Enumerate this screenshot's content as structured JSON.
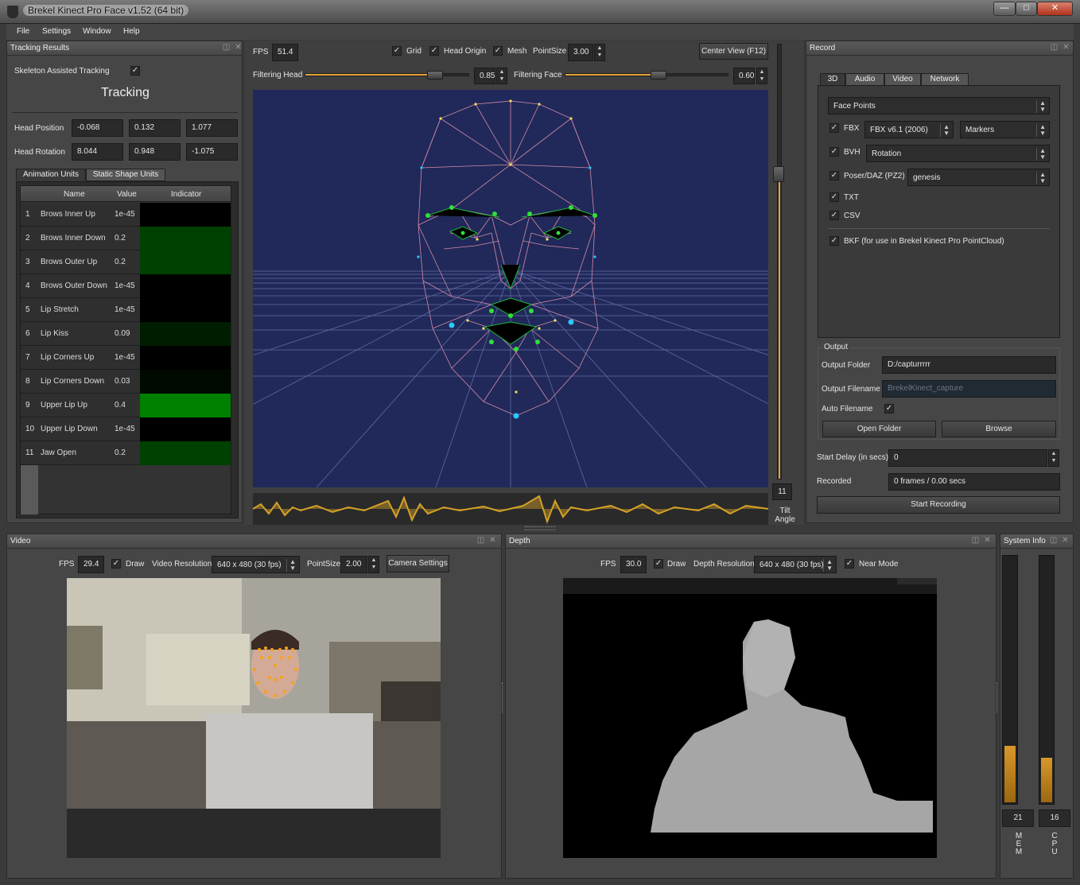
{
  "window": {
    "title": "Brekel Kinect Pro Face v1.52 (64 bit)",
    "min": "—",
    "max": "□",
    "close": "✕"
  },
  "menu": [
    "File",
    "Settings",
    "Window",
    "Help"
  ],
  "tracking": {
    "panel_title": "Tracking Results",
    "skeleton_label": "Skeleton Assisted Tracking",
    "status": "Tracking",
    "head_position_label": "Head Position",
    "head_position": [
      "-0.068",
      "0.132",
      "1.077"
    ],
    "head_rotation_label": "Head Rotation",
    "head_rotation": [
      "8.044",
      "0.948",
      "-1.075"
    ],
    "tabs": [
      "Animation Units",
      "Static Shape Units"
    ],
    "columns": [
      "Name",
      "Value",
      "Indicator"
    ],
    "rows": [
      {
        "n": "1",
        "name": "Brows Inner Up",
        "value": "1e-45",
        "level": 0
      },
      {
        "n": "2",
        "name": "Brows Inner Down",
        "value": "0.2",
        "level": 0.2
      },
      {
        "n": "3",
        "name": "Brows Outer Up",
        "value": "0.2",
        "level": 0.2
      },
      {
        "n": "4",
        "name": "Brows Outer Down",
        "value": "1e-45",
        "level": 0
      },
      {
        "n": "5",
        "name": "Lip Stretch",
        "value": "1e-45",
        "level": 0
      },
      {
        "n": "6",
        "name": "Lip Kiss",
        "value": "0.09",
        "level": 0.09
      },
      {
        "n": "7",
        "name": "Lip Corners Up",
        "value": "1e-45",
        "level": 0
      },
      {
        "n": "8",
        "name": "Lip Corners Down",
        "value": "0.03",
        "level": 0.03
      },
      {
        "n": "9",
        "name": "Upper Lip Up",
        "value": "0.4",
        "level": 0.4
      },
      {
        "n": "10",
        "name": "Upper Lip Down",
        "value": "1e-45",
        "level": 0
      },
      {
        "n": "11",
        "name": "Jaw Open",
        "value": "0.2",
        "level": 0.2
      }
    ]
  },
  "view3d": {
    "fps_label": "FPS",
    "fps": "51.4",
    "grid_label": "Grid",
    "head_origin_label": "Head Origin",
    "mesh_label": "Mesh",
    "pointsize_label": "PointSize",
    "pointsize": "3.00",
    "center_view": "Center View (F12)",
    "filter_head_label": "Filtering Head",
    "filter_head": "0.85",
    "filter_face_label": "Filtering Face",
    "filter_face": "0.60",
    "tilt_value": "11",
    "tilt_label_1": "Tilt",
    "tilt_label_2": "Angle"
  },
  "record": {
    "panel_title": "Record",
    "tabs": [
      "3D",
      "Audio",
      "Video",
      "Network"
    ],
    "face_points": "Face Points",
    "fbx_label": "FBX",
    "fbx_version": "FBX v6.1 (2006)",
    "fbx_mode": "Markers",
    "bvh_label": "BVH",
    "bvh_mode": "Rotation",
    "poser_label": "Poser/DAZ (PZ2)",
    "poser_mode": "genesis",
    "txt_label": "TXT",
    "csv_label": "CSV",
    "bkf_label": "BKF (for use in Brekel Kinect Pro PointCloud)",
    "output_group": "Output",
    "output_folder_label": "Output Folder",
    "output_folder": "D:/capturrrrr",
    "output_filename_label": "Output Filename",
    "output_filename_placeholder": "BrekelKinect_capture",
    "auto_filename_label": "Auto Filename",
    "open_folder": "Open Folder",
    "browse": "Browse",
    "start_delay_label": "Start Delay (in secs)",
    "start_delay": "0",
    "recorded_label": "Recorded",
    "recorded": "0 frames / 0.00 secs",
    "start_recording": "Start Recording"
  },
  "video": {
    "panel_title": "Video",
    "fps_label": "FPS",
    "fps": "29.4",
    "draw_label": "Draw",
    "res_label": "Video Resolution",
    "resolution": "640 x 480  (30 fps)",
    "pointsize_label": "PointSize",
    "pointsize": "2.00",
    "camera_settings": "Camera Settings"
  },
  "depth": {
    "panel_title": "Depth",
    "fps_label": "FPS",
    "fps": "30.0",
    "draw_label": "Draw",
    "res_label": "Depth Resolution",
    "resolution": "640 x 480 (30 fps)",
    "near_mode_label": "Near Mode"
  },
  "sysinfo": {
    "panel_title": "System Info",
    "mem": "21",
    "cpu": "16",
    "mem_level": 0.23,
    "cpu_level": 0.18,
    "mem_label": [
      "M",
      "E",
      "M"
    ],
    "cpu_label": [
      "C",
      "P",
      "U"
    ]
  }
}
